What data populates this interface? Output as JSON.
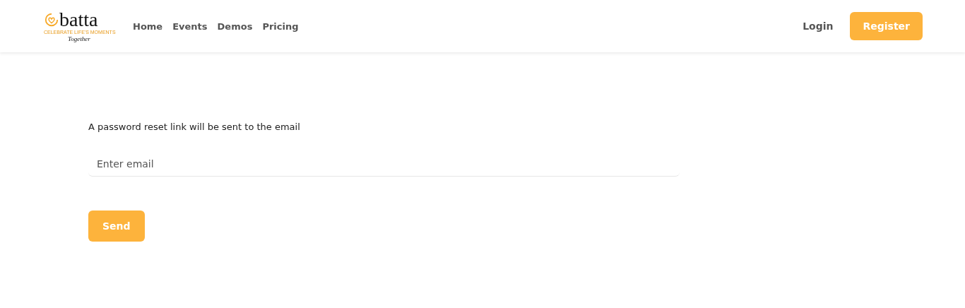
{
  "header": {
    "logo": {
      "name": "batta",
      "tagline": "CELEBRATE LIFE'S MOMENTS",
      "signature": "Together"
    },
    "nav": [
      {
        "label": "Home"
      },
      {
        "label": "Events"
      },
      {
        "label": "Demos"
      },
      {
        "label": "Pricing"
      }
    ],
    "login": "Login",
    "register": "Register"
  },
  "form": {
    "message": "A password reset link will be sent to the email",
    "email": {
      "placeholder": "Enter email"
    },
    "submit": "Send"
  }
}
